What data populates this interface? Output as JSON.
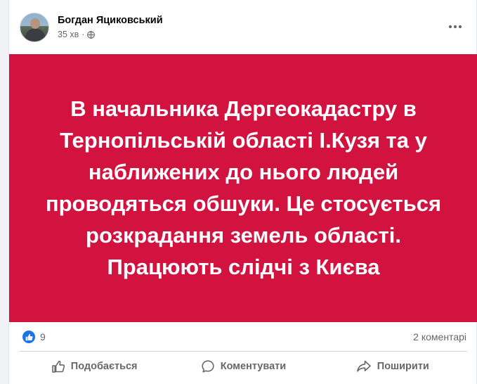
{
  "post": {
    "author": "Богдан Яциковський",
    "time": "35 хв",
    "separator": "·",
    "privacy_icon": "globe-icon",
    "banner_text": "В начальника Дергеокадастру в Тернопільській області І.Кузя та у наближених до нього людей проводяться обшуки. Це стосується розкрадання земель області. Працюють слідчі з Києва",
    "banner_color": "#d2123f"
  },
  "stats": {
    "likes": "9",
    "comments": "2 коментарі"
  },
  "actions": {
    "like_label": "Подобається",
    "comment_label": "Коментувати",
    "share_label": "Поширити"
  },
  "colors": {
    "accent": "#1b74e4",
    "secondary_text": "#65676b"
  }
}
